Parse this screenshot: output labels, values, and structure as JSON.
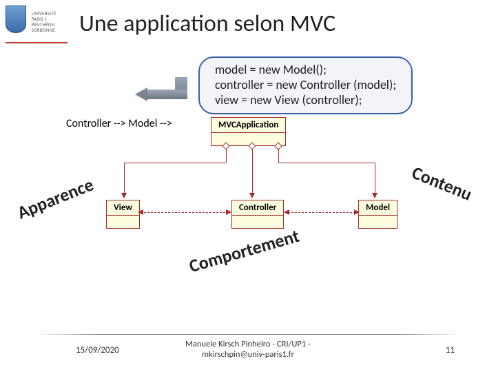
{
  "logo": {
    "line1": "UNIVERSITÉ",
    "line2": "PARIS 1",
    "line3": "PANTHÉON",
    "line4": "SORBONNE"
  },
  "title": "Une application selon MVC",
  "code": {
    "l1": "model = new Model();",
    "l2": "controller = new Controller (model);",
    "l3": "view = new View (controller);"
  },
  "uml": {
    "app": "MVCApplication",
    "view": "View",
    "controller": "Controller",
    "model": "Model"
  },
  "labels": {
    "apparence": "Apparence",
    "contenu": "Contenu",
    "comportement": "Comportement"
  },
  "footer": {
    "date": "15/09/2020",
    "author_line1": "Manuele Kirsch Pinheiro - CRI/UP1 -",
    "author_line2": "mkirschpin@univ-paris1.fr",
    "page": "11"
  }
}
